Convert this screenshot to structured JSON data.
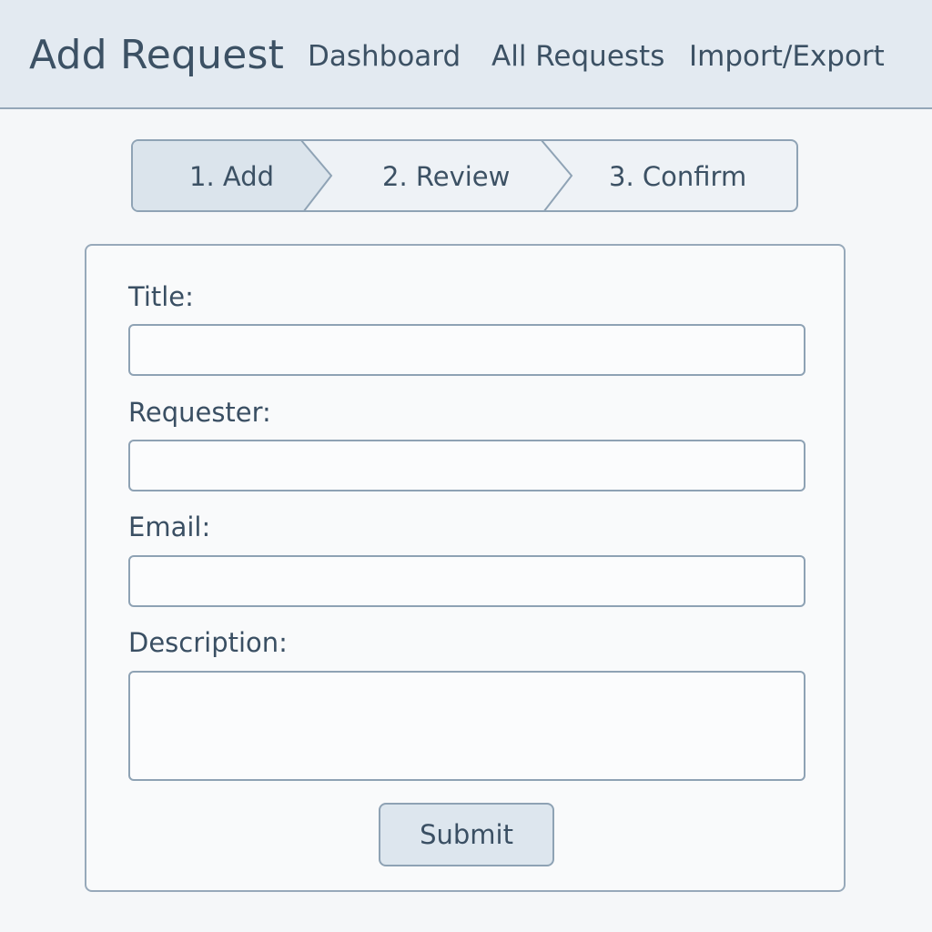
{
  "header": {
    "title": "Add Request",
    "nav": [
      {
        "label": "Dashboard"
      },
      {
        "label": "All Requests"
      },
      {
        "label": "Import/Export"
      }
    ]
  },
  "stepper": {
    "steps": [
      {
        "label": "1. Add",
        "active": true
      },
      {
        "label": "2. Review",
        "active": false
      },
      {
        "label": "3. Confirm",
        "active": false
      }
    ]
  },
  "form": {
    "fields": [
      {
        "label": "Title:",
        "value": "",
        "placeholder": ""
      },
      {
        "label": "Requester:",
        "value": "",
        "placeholder": ""
      },
      {
        "label": "Email:",
        "value": "",
        "placeholder": ""
      },
      {
        "label": "Description:",
        "value": "",
        "placeholder": ""
      }
    ],
    "submit_label": "Submit"
  },
  "colors": {
    "header_bg": "#e3eaf1",
    "border": "#8fa3b5",
    "text": "#3a4f63",
    "active_step_bg": "#dbe4ec",
    "page_bg": "#f5f7f9"
  }
}
